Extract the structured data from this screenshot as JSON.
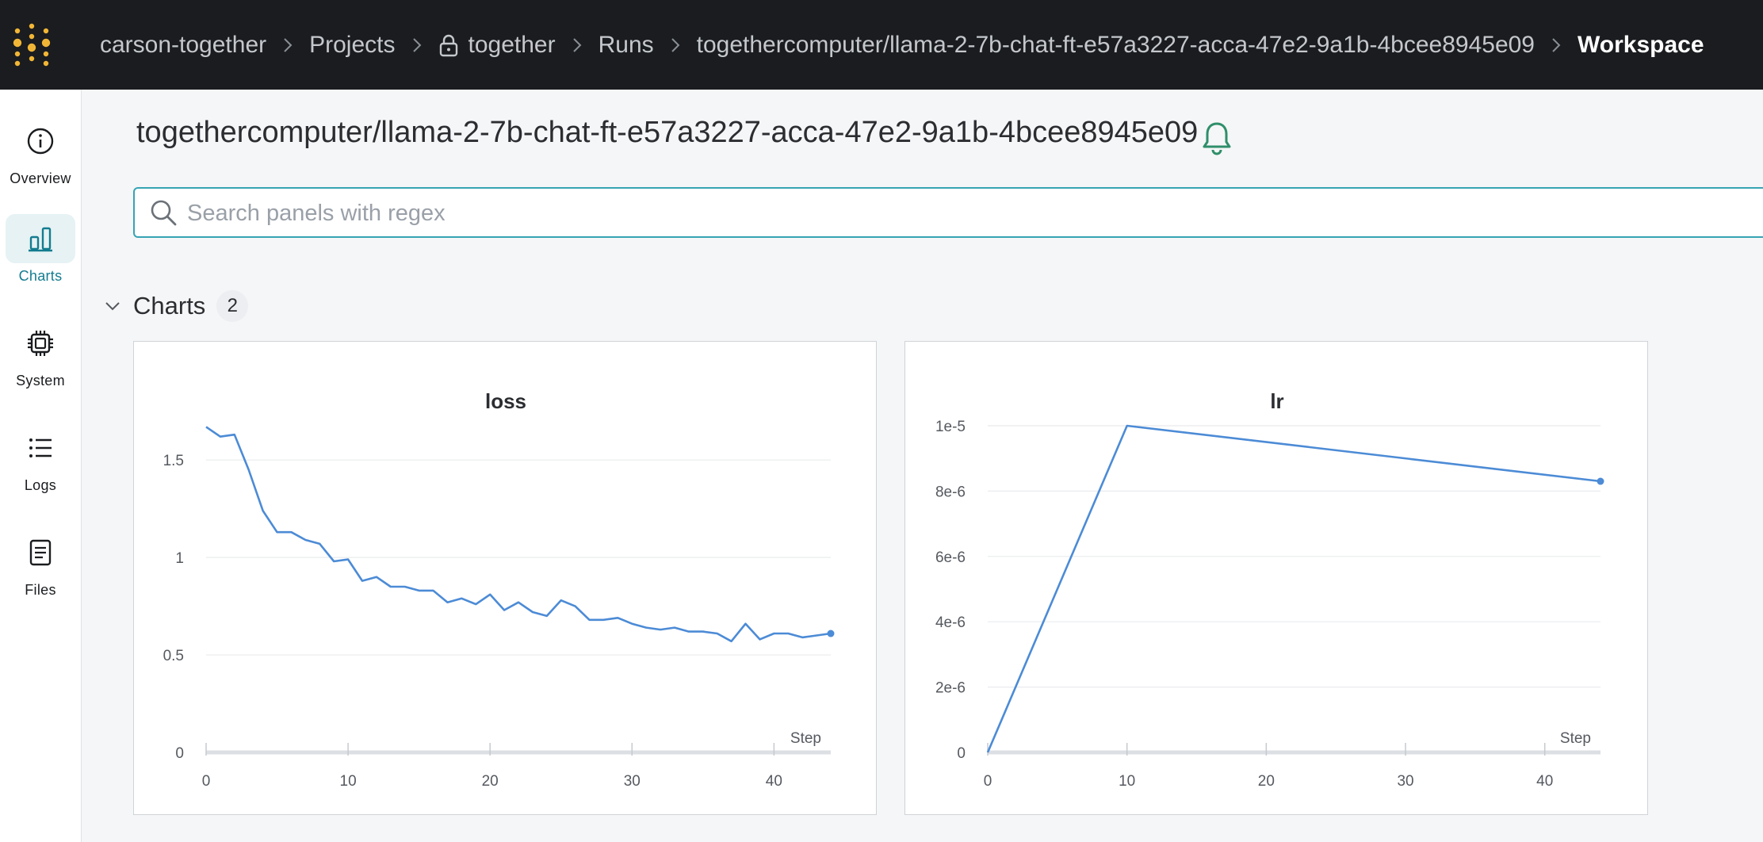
{
  "breadcrumb": {
    "items": [
      "carson-together",
      "Projects",
      "together",
      "Runs",
      "togethercomputer/llama-2-7b-chat-ft-e57a3227-acca-47e2-9a1b-4bcee8945e09",
      "Workspace"
    ]
  },
  "sidebar": {
    "items": [
      {
        "label": "Overview",
        "icon": "info-icon"
      },
      {
        "label": "Charts",
        "icon": "bar-chart-icon",
        "active": true
      },
      {
        "label": "System",
        "icon": "chip-icon"
      },
      {
        "label": "Logs",
        "icon": "list-icon"
      },
      {
        "label": "Files",
        "icon": "file-icon"
      }
    ]
  },
  "run": {
    "title": "togethercomputer/llama-2-7b-chat-ft-e57a3227-acca-47e2-9a1b-4bcee8945e09"
  },
  "search": {
    "placeholder": "Search panels with regex",
    "value": ""
  },
  "section": {
    "title": "Charts",
    "count": "2"
  },
  "colors": {
    "accent": "#137c8f",
    "line": "#4c8bd6",
    "topbar": "#1a1c1f",
    "logo": "#f2b636",
    "bell": "#2f8f6b"
  },
  "chart_data": [
    {
      "type": "line",
      "title": "loss",
      "xlabel": "Step",
      "ylabel": "",
      "xlim": [
        0,
        44
      ],
      "ylim": [
        0,
        1.7
      ],
      "xticks": [
        "0",
        "10",
        "20",
        "30",
        "40"
      ],
      "yticks": [
        "0",
        "0.5",
        "1",
        "1.5"
      ],
      "grid": true,
      "x": [
        0,
        1,
        2,
        3,
        4,
        5,
        6,
        7,
        8,
        9,
        10,
        11,
        12,
        13,
        14,
        15,
        16,
        17,
        18,
        19,
        20,
        21,
        22,
        23,
        24,
        25,
        26,
        27,
        28,
        29,
        30,
        31,
        32,
        33,
        34,
        35,
        36,
        37,
        38,
        39,
        40,
        41,
        42,
        43,
        44
      ],
      "y": [
        1.67,
        1.62,
        1.63,
        1.45,
        1.24,
        1.13,
        1.13,
        1.09,
        1.07,
        0.98,
        0.99,
        0.88,
        0.9,
        0.85,
        0.85,
        0.83,
        0.83,
        0.77,
        0.79,
        0.76,
        0.81,
        0.73,
        0.77,
        0.72,
        0.7,
        0.78,
        0.75,
        0.68,
        0.68,
        0.69,
        0.66,
        0.64,
        0.63,
        0.64,
        0.62,
        0.62,
        0.61,
        0.57,
        0.66,
        0.58,
        0.61,
        0.61,
        0.59,
        0.6,
        0.61
      ]
    },
    {
      "type": "line",
      "title": "lr",
      "xlabel": "Step",
      "ylabel": "",
      "xlim": [
        0,
        44
      ],
      "ylim": [
        0,
        1e-05
      ],
      "xticks": [
        "0",
        "10",
        "20",
        "30",
        "40"
      ],
      "yticks": [
        "0",
        "2e-6",
        "4e-6",
        "6e-6",
        "8e-6",
        "1e-5"
      ],
      "grid": true,
      "x": [
        0,
        10,
        44
      ],
      "y": [
        0,
        1e-05,
        8.3e-06
      ]
    }
  ]
}
